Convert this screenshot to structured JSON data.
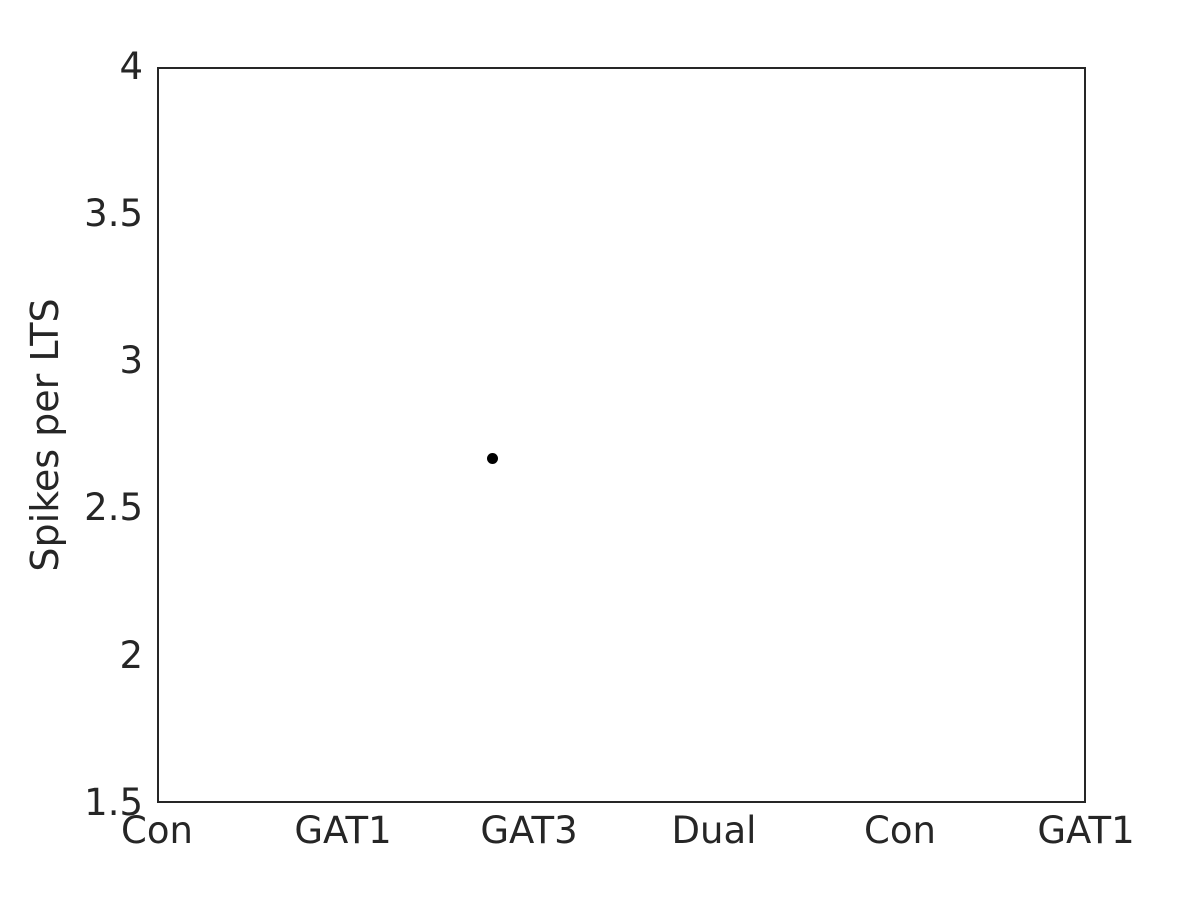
{
  "chart_data": {
    "type": "scatter",
    "title": "",
    "xlabel": "",
    "ylabel": "Spikes per LTS",
    "categories": [
      "Con",
      "GAT1",
      "GAT3",
      "Dual",
      "Con",
      "GAT1"
    ],
    "x_tick_labels": [
      "Con",
      "GAT1",
      "GAT3",
      "Dual",
      "Con",
      "GAT1"
    ],
    "y_tick_labels": [
      "1.5",
      "2",
      "2.5",
      "3",
      "3.5",
      "4"
    ],
    "y_tick_values": [
      1.5,
      2,
      2.5,
      3,
      3.5,
      4
    ],
    "ylim": [
      1.5,
      4
    ],
    "xlim": [
      0,
      6
    ],
    "grid": false,
    "legend": null,
    "series": [
      {
        "name": "Spikes per LTS",
        "marker": "circle",
        "color": "#000000",
        "points": [
          {
            "x_category": "GAT3",
            "x": 2.16,
            "y": 2.67
          }
        ]
      }
    ],
    "axis_color": "#262626",
    "background_color": "#ffffff"
  }
}
